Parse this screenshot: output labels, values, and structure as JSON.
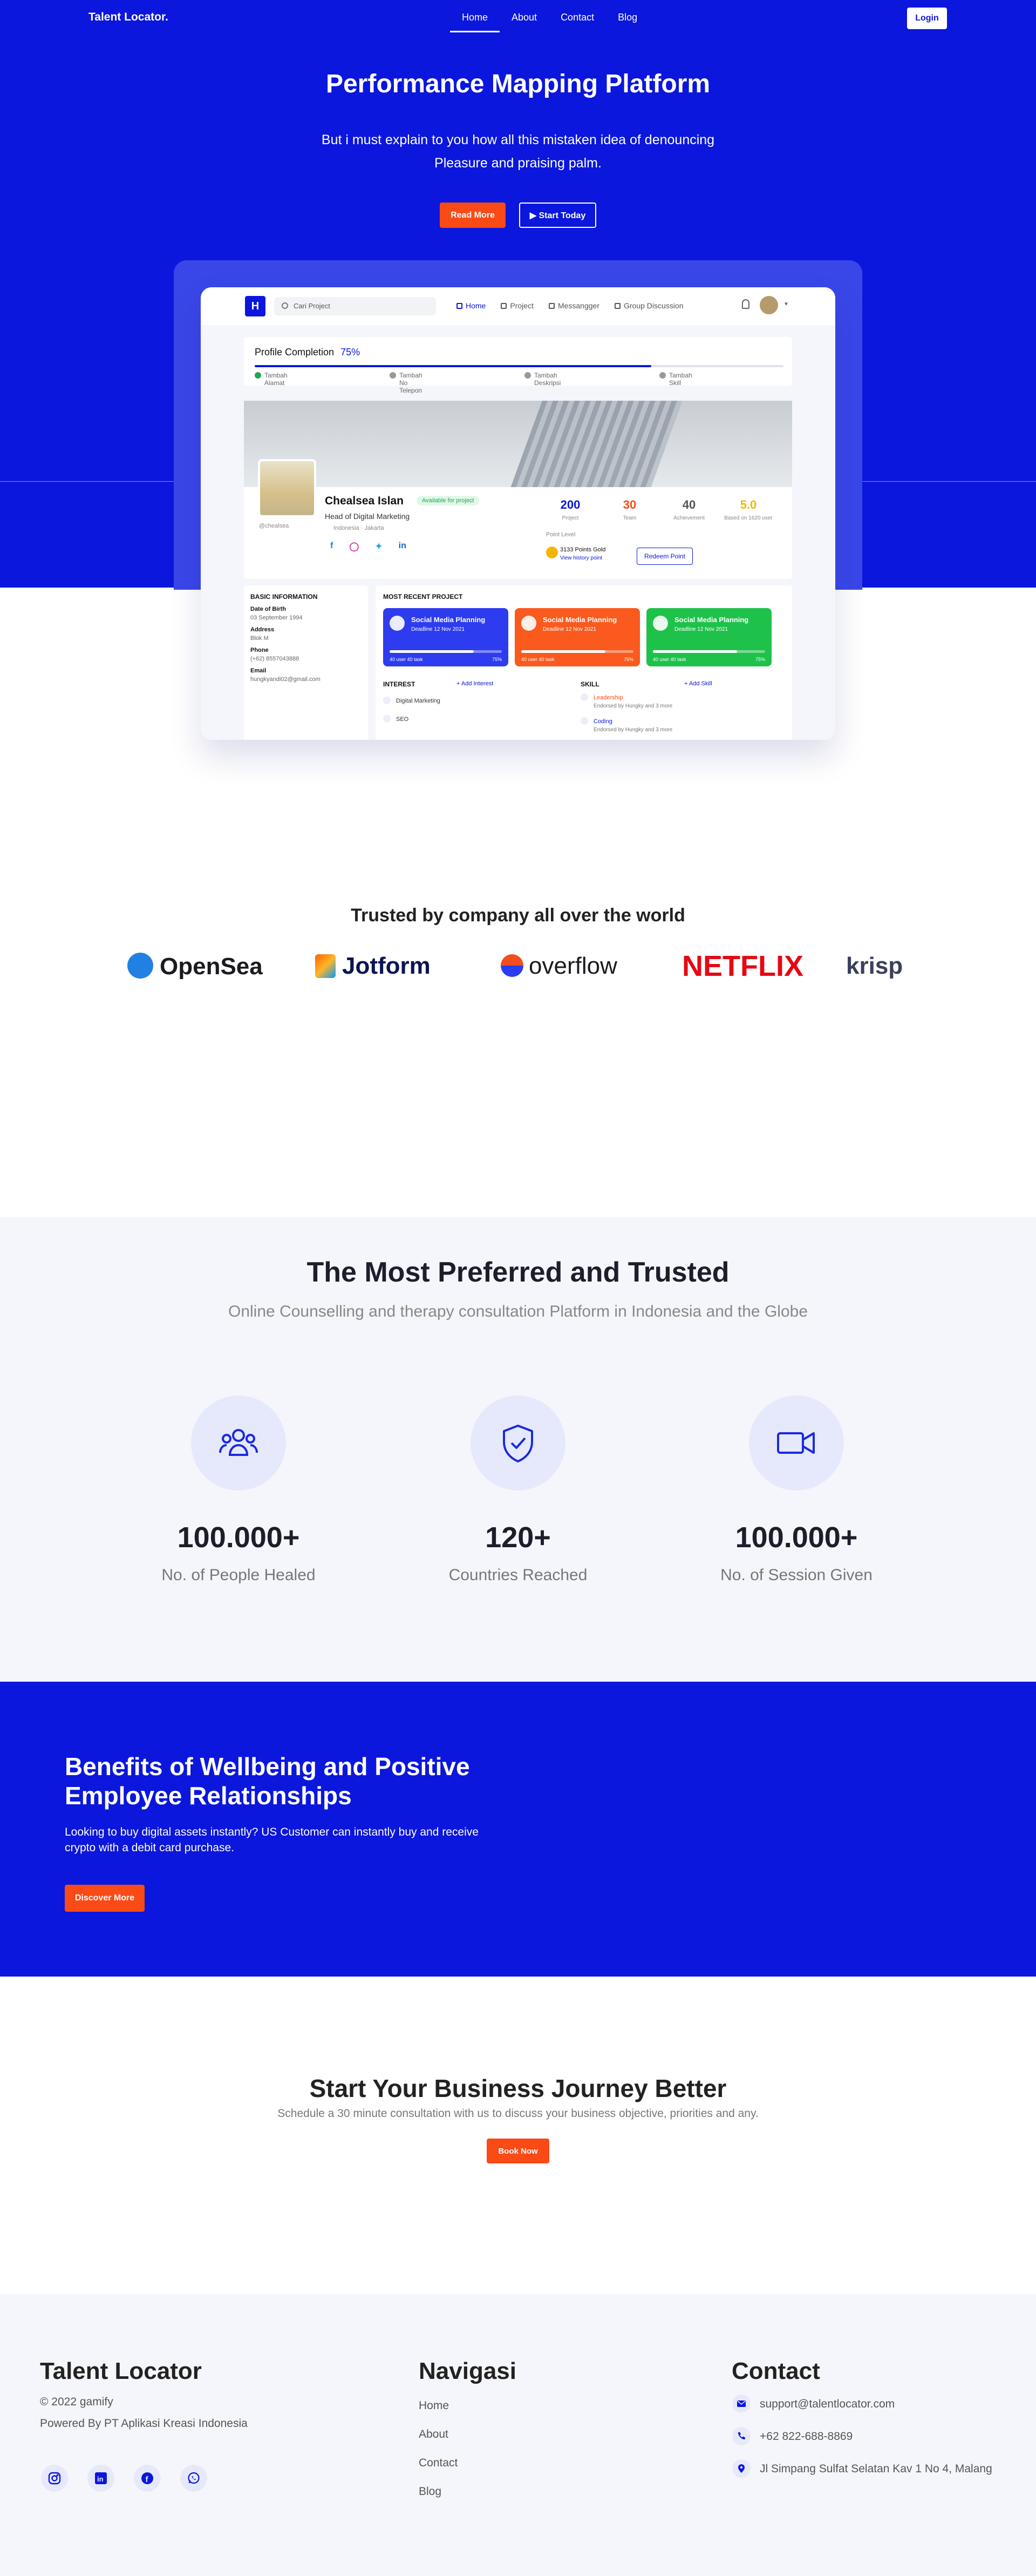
{
  "nav": {
    "logo": "Talent Locator.",
    "links": [
      "Home",
      "About",
      "Contact",
      "Blog"
    ],
    "login": "Login"
  },
  "hero": {
    "title": "Performance Mapping Platform",
    "subtitle": "But i must explain to you how all this mistaken idea of denouncing Pleasure and praising palm.",
    "read_more": "Read More",
    "start_today": "Start Today"
  },
  "mockup": {
    "logo": "H",
    "search_placeholder": "Cari Project",
    "tabs": [
      "Home",
      "Project",
      "Messangger",
      "Group Discussion"
    ],
    "progress": {
      "label": "Profile Completion",
      "percent": "75%",
      "value": 0.75,
      "steps": [
        "Tambah Alamat",
        "Tambah No Telepon",
        "Tambah Deskripsi",
        "Tambah Skill"
      ]
    },
    "profile": {
      "name": "Chealsea Islan",
      "status": "Available for project",
      "role": "Head of Digital Marketing",
      "location": "Indonesia · Jakarta",
      "username": "@chealsea",
      "stats": [
        {
          "value": "200",
          "label": "Project",
          "color": "#0b17dc"
        },
        {
          "value": "30",
          "label": "Team",
          "color": "#fa4a16"
        },
        {
          "value": "40",
          "label": "Achievement",
          "color": "#555555"
        },
        {
          "value": "5.0",
          "label": "Based on 1620 user",
          "color": "#f2b705"
        }
      ],
      "point_level": "Point Level",
      "points": "3133 Points Gold",
      "view_history": "View history point",
      "redeem": "Redeem Point"
    },
    "basic": {
      "title": "BASIC INFORMATION",
      "fields": [
        {
          "label": "Date of Birth",
          "value": "03 September 1994"
        },
        {
          "label": "Address",
          "value": "Blok M"
        },
        {
          "label": "Phone",
          "value": "(+62) 8557043888"
        },
        {
          "label": "Email",
          "value": "hungkyandi02@gmail.com"
        }
      ]
    },
    "recent": {
      "title": "MOST RECENT PROJECT",
      "projects": [
        {
          "title": "Social Media Planning",
          "deadline": "Deadline 12 Nov 2021",
          "members": "40 user 40 task",
          "percent": "75%",
          "color": "#2e3cf0"
        },
        {
          "title": "Social Media Planning",
          "deadline": "Deadline 12 Nov 2021",
          "members": "40 user 40 task",
          "percent": "75%",
          "color": "#fa5a1e"
        },
        {
          "title": "Social Media Planning",
          "deadline": "Deadline 12 Nov 2021",
          "members": "40 user 40 task",
          "percent": "75%",
          "color": "#1ec24a"
        }
      ],
      "interest_title": "INTEREST",
      "add_interest": "+ Add Interest",
      "interests": [
        "Digital Marketing",
        "SEO"
      ],
      "skill_title": "SKILL",
      "add_skill": "+ Add Skill",
      "skills": [
        {
          "name": "Leadership",
          "endorsed": "Endorsed by Hungky and 3 more"
        },
        {
          "name": "Coding",
          "endorsed": "Endorsed by Hungky and 3 more"
        }
      ]
    }
  },
  "trusted": {
    "title": "Trusted by company all over the world",
    "logos": [
      {
        "name": "OpenSea",
        "color": "#1b1b1f"
      },
      {
        "name": "Jotform",
        "color": "#0a1551"
      },
      {
        "name": "overflow",
        "color": "#1b1b1f"
      },
      {
        "name": "NETFLIX",
        "color": "#e50914"
      },
      {
        "name": "krisp",
        "color": "#3a3f5c"
      }
    ]
  },
  "stats": {
    "title": "The Most Preferred and Trusted",
    "subtitle": "Online Counselling and therapy consultation Platform in Indonesia and the Globe",
    "items": [
      {
        "value": "100.000+",
        "label": "No. of People Healed",
        "icon": "people-icon"
      },
      {
        "value": "120+",
        "label": "Countries Reached",
        "icon": "shield-check-icon"
      },
      {
        "value": "100.000+",
        "label": "No. of Session Given",
        "icon": "video-camera-icon"
      }
    ]
  },
  "benefits": {
    "title": "Benefits of Wellbeing and Positive Employee Relationships",
    "subtitle": "Looking to buy digital assets instantly? US Customer can instantly buy and receive crypto with a debit card purchase.",
    "button": "Discover More"
  },
  "cta": {
    "title": "Start Your Business Journey Better",
    "subtitle": "Schedule a 30 minute consultation with us to discuss your business objective, priorities and any.",
    "button": "Book Now"
  },
  "footer": {
    "brand": "Talent Locator",
    "copyright": "© 2022 gamify",
    "powered": "Powered By PT Aplikasi Kreasi Indonesia",
    "nav_title": "Navigasi",
    "nav_links": [
      "Home",
      "About",
      "Contact",
      "Blog"
    ],
    "contact_title": "Contact",
    "email": "support@talentlocator.com",
    "phone": "+62 822-688-8869",
    "address": "Jl Simpang Sulfat Selatan Kav 1 No 4, Malang"
  },
  "colors": {
    "primary": "#0b17dc",
    "accent": "#fa4a16"
  }
}
